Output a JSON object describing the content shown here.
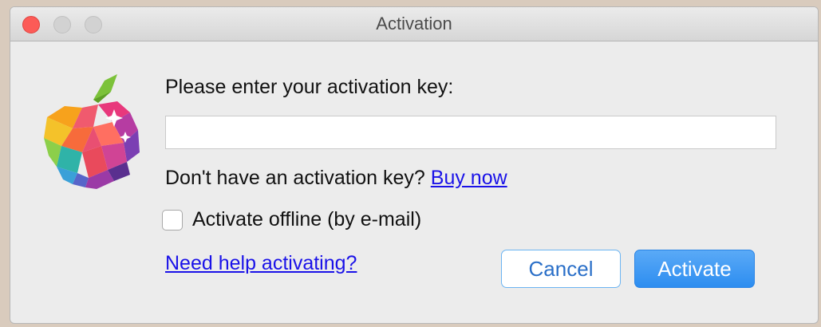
{
  "window": {
    "title": "Activation"
  },
  "form": {
    "prompt": "Please enter your activation key:",
    "key_value": "",
    "key_placeholder": "",
    "no_key_text": "Don't have an activation key?",
    "buy_now_link": "Buy now",
    "offline_checkbox_label": "Activate offline (by e-mail)",
    "offline_checked": false,
    "help_link": "Need help activating?"
  },
  "buttons": {
    "cancel_label": "Cancel",
    "activate_label": "Activate"
  },
  "colors": {
    "link": "#1a12e8",
    "primary_button": "#3d97f2",
    "close_button": "#fc5b57"
  },
  "icons": {
    "app": "polygon-apple-icon"
  }
}
